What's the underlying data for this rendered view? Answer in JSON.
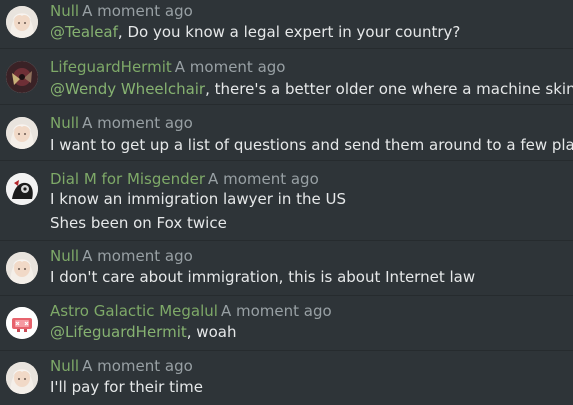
{
  "messages": [
    {
      "user": "Null",
      "time": "A moment ago",
      "mention": "@Tealeaf",
      "text": ", Do you know a legal expert in your country?",
      "avatar": "null-avatar"
    },
    {
      "user": "LifeguardHermit",
      "time": "A moment ago",
      "mention": "@Wendy Wheelchair",
      "text": ", there's a better older one where a machine skins a guy",
      "avatar": "lifeguardhermit-avatar"
    },
    {
      "user": "Null",
      "time": "A moment ago",
      "text": "I want to get up a list of questions and send them around to a few places",
      "avatar": "null-avatar"
    },
    {
      "user": "Dial M for Misgender",
      "time": "A moment ago",
      "text": "I know an immigration lawyer in the US",
      "text2": "Shes been on Fox twice",
      "avatar": "dialm-avatar"
    },
    {
      "user": "Null",
      "time": "A moment ago",
      "text": "I don't care about immigration, this is about Internet law",
      "avatar": "null-avatar"
    },
    {
      "user": "Astro Galactic Megalul",
      "time": "A moment ago",
      "mention": "@LifeguardHermit",
      "text": ", woah",
      "avatar": "astro-avatar"
    },
    {
      "user": "Null",
      "time": "A moment ago",
      "text": "I'll pay for their time",
      "avatar": "null-avatar"
    }
  ]
}
